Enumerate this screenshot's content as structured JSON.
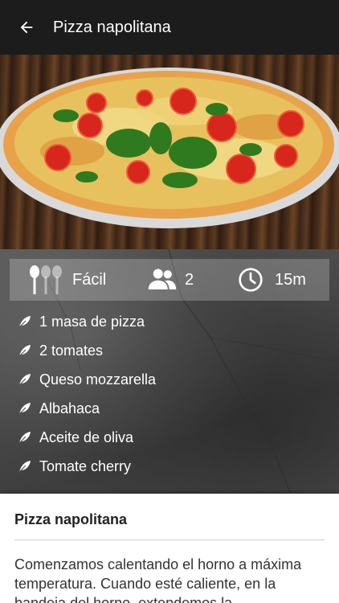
{
  "appbar": {
    "title": "Pizza napolitana",
    "back_icon": "arrow-left-icon"
  },
  "hero": {
    "image": "pizza-photo"
  },
  "stats": {
    "difficulty": "Fácil",
    "servings": "2",
    "time": "15m"
  },
  "ingredients": [
    "1 masa de pizza",
    "2 tomates",
    "Queso mozzarella",
    "Albahaca",
    "Aceite de oliva",
    "Tomate cherry"
  ],
  "recipe": {
    "title": "Pizza napolitana",
    "text": "Comenzamos calentando el horno a máxima temperatura. Cuando esté caliente, en la bandeja del horno, extendemos la"
  },
  "colors": {
    "appbar": "#1c1c1c",
    "card": "#ffffff"
  }
}
